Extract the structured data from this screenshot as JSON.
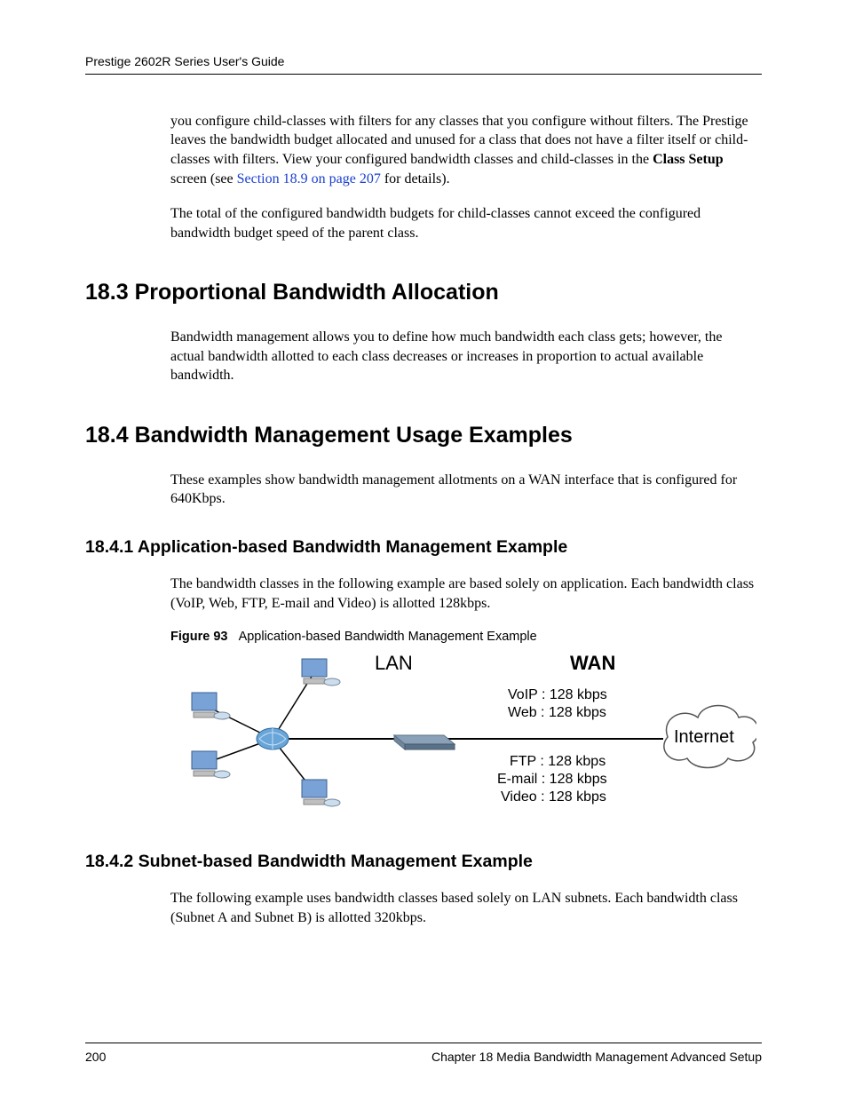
{
  "header": {
    "guide_title": "Prestige 2602R Series User's Guide"
  },
  "body": {
    "p1_a": "you configure child-classes with filters for any classes that you configure without filters. The Prestige leaves the bandwidth budget allocated and unused for a class that does not have a filter itself or child-classes with filters. View your configured bandwidth classes and child-classes in the ",
    "p1_bold": "Class Setup",
    "p1_b": " screen (see ",
    "p1_link": "Section 18.9 on page 207",
    "p1_c": " for details).",
    "p2": "The total of the configured bandwidth budgets for child-classes cannot exceed the configured bandwidth budget speed of the parent class."
  },
  "s183": {
    "heading": "18.3  Proportional Bandwidth Allocation",
    "p1": "Bandwidth management allows you to define how much bandwidth each class gets; however, the actual bandwidth allotted to each class decreases or increases in proportion to actual available bandwidth."
  },
  "s184": {
    "heading": "18.4  Bandwidth Management Usage Examples",
    "p1": "These examples show bandwidth management allotments on a WAN interface that is configured for 640Kbps."
  },
  "s1841": {
    "heading": "18.4.1  Application-based Bandwidth Management Example",
    "p1": "The bandwidth classes in the following example are based solely on application. Each bandwidth class (VoIP, Web, FTP, E-mail and Video) is allotted 128kbps."
  },
  "figure93": {
    "label": "Figure 93",
    "title": "Application-based Bandwidth Management Example",
    "diagram": {
      "lan_label": "LAN",
      "wan_label": "WAN",
      "internet_label": "Internet",
      "upper": [
        "VoIP : 128 kbps",
        "Web : 128 kbps"
      ],
      "lower": [
        "FTP : 128 kbps",
        "E-mail : 128 kbps",
        "Video : 128 kbps"
      ]
    }
  },
  "s1842": {
    "heading": "18.4.2  Subnet-based Bandwidth Management Example",
    "p1": "The following example uses bandwidth classes based solely on LAN subnets. Each bandwidth class (Subnet A and Subnet B) is allotted 320kbps."
  },
  "footer": {
    "page": "200",
    "chapter": "Chapter 18 Media Bandwidth Management Advanced Setup"
  }
}
